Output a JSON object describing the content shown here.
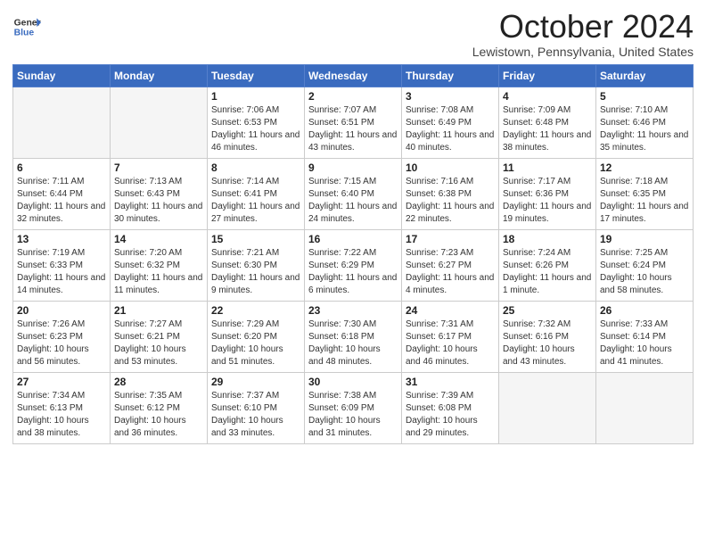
{
  "header": {
    "logo_line1": "General",
    "logo_line2": "Blue",
    "month": "October 2024",
    "location": "Lewistown, Pennsylvania, United States"
  },
  "days_of_week": [
    "Sunday",
    "Monday",
    "Tuesday",
    "Wednesday",
    "Thursday",
    "Friday",
    "Saturday"
  ],
  "weeks": [
    [
      {
        "num": "",
        "info": ""
      },
      {
        "num": "",
        "info": ""
      },
      {
        "num": "1",
        "info": "Sunrise: 7:06 AM\nSunset: 6:53 PM\nDaylight: 11 hours and 46 minutes."
      },
      {
        "num": "2",
        "info": "Sunrise: 7:07 AM\nSunset: 6:51 PM\nDaylight: 11 hours and 43 minutes."
      },
      {
        "num": "3",
        "info": "Sunrise: 7:08 AM\nSunset: 6:49 PM\nDaylight: 11 hours and 40 minutes."
      },
      {
        "num": "4",
        "info": "Sunrise: 7:09 AM\nSunset: 6:48 PM\nDaylight: 11 hours and 38 minutes."
      },
      {
        "num": "5",
        "info": "Sunrise: 7:10 AM\nSunset: 6:46 PM\nDaylight: 11 hours and 35 minutes."
      }
    ],
    [
      {
        "num": "6",
        "info": "Sunrise: 7:11 AM\nSunset: 6:44 PM\nDaylight: 11 hours and 32 minutes."
      },
      {
        "num": "7",
        "info": "Sunrise: 7:13 AM\nSunset: 6:43 PM\nDaylight: 11 hours and 30 minutes."
      },
      {
        "num": "8",
        "info": "Sunrise: 7:14 AM\nSunset: 6:41 PM\nDaylight: 11 hours and 27 minutes."
      },
      {
        "num": "9",
        "info": "Sunrise: 7:15 AM\nSunset: 6:40 PM\nDaylight: 11 hours and 24 minutes."
      },
      {
        "num": "10",
        "info": "Sunrise: 7:16 AM\nSunset: 6:38 PM\nDaylight: 11 hours and 22 minutes."
      },
      {
        "num": "11",
        "info": "Sunrise: 7:17 AM\nSunset: 6:36 PM\nDaylight: 11 hours and 19 minutes."
      },
      {
        "num": "12",
        "info": "Sunrise: 7:18 AM\nSunset: 6:35 PM\nDaylight: 11 hours and 17 minutes."
      }
    ],
    [
      {
        "num": "13",
        "info": "Sunrise: 7:19 AM\nSunset: 6:33 PM\nDaylight: 11 hours and 14 minutes."
      },
      {
        "num": "14",
        "info": "Sunrise: 7:20 AM\nSunset: 6:32 PM\nDaylight: 11 hours and 11 minutes."
      },
      {
        "num": "15",
        "info": "Sunrise: 7:21 AM\nSunset: 6:30 PM\nDaylight: 11 hours and 9 minutes."
      },
      {
        "num": "16",
        "info": "Sunrise: 7:22 AM\nSunset: 6:29 PM\nDaylight: 11 hours and 6 minutes."
      },
      {
        "num": "17",
        "info": "Sunrise: 7:23 AM\nSunset: 6:27 PM\nDaylight: 11 hours and 4 minutes."
      },
      {
        "num": "18",
        "info": "Sunrise: 7:24 AM\nSunset: 6:26 PM\nDaylight: 11 hours and 1 minute."
      },
      {
        "num": "19",
        "info": "Sunrise: 7:25 AM\nSunset: 6:24 PM\nDaylight: 10 hours and 58 minutes."
      }
    ],
    [
      {
        "num": "20",
        "info": "Sunrise: 7:26 AM\nSunset: 6:23 PM\nDaylight: 10 hours and 56 minutes."
      },
      {
        "num": "21",
        "info": "Sunrise: 7:27 AM\nSunset: 6:21 PM\nDaylight: 10 hours and 53 minutes."
      },
      {
        "num": "22",
        "info": "Sunrise: 7:29 AM\nSunset: 6:20 PM\nDaylight: 10 hours and 51 minutes."
      },
      {
        "num": "23",
        "info": "Sunrise: 7:30 AM\nSunset: 6:18 PM\nDaylight: 10 hours and 48 minutes."
      },
      {
        "num": "24",
        "info": "Sunrise: 7:31 AM\nSunset: 6:17 PM\nDaylight: 10 hours and 46 minutes."
      },
      {
        "num": "25",
        "info": "Sunrise: 7:32 AM\nSunset: 6:16 PM\nDaylight: 10 hours and 43 minutes."
      },
      {
        "num": "26",
        "info": "Sunrise: 7:33 AM\nSunset: 6:14 PM\nDaylight: 10 hours and 41 minutes."
      }
    ],
    [
      {
        "num": "27",
        "info": "Sunrise: 7:34 AM\nSunset: 6:13 PM\nDaylight: 10 hours and 38 minutes."
      },
      {
        "num": "28",
        "info": "Sunrise: 7:35 AM\nSunset: 6:12 PM\nDaylight: 10 hours and 36 minutes."
      },
      {
        "num": "29",
        "info": "Sunrise: 7:37 AM\nSunset: 6:10 PM\nDaylight: 10 hours and 33 minutes."
      },
      {
        "num": "30",
        "info": "Sunrise: 7:38 AM\nSunset: 6:09 PM\nDaylight: 10 hours and 31 minutes."
      },
      {
        "num": "31",
        "info": "Sunrise: 7:39 AM\nSunset: 6:08 PM\nDaylight: 10 hours and 29 minutes."
      },
      {
        "num": "",
        "info": ""
      },
      {
        "num": "",
        "info": ""
      }
    ]
  ]
}
